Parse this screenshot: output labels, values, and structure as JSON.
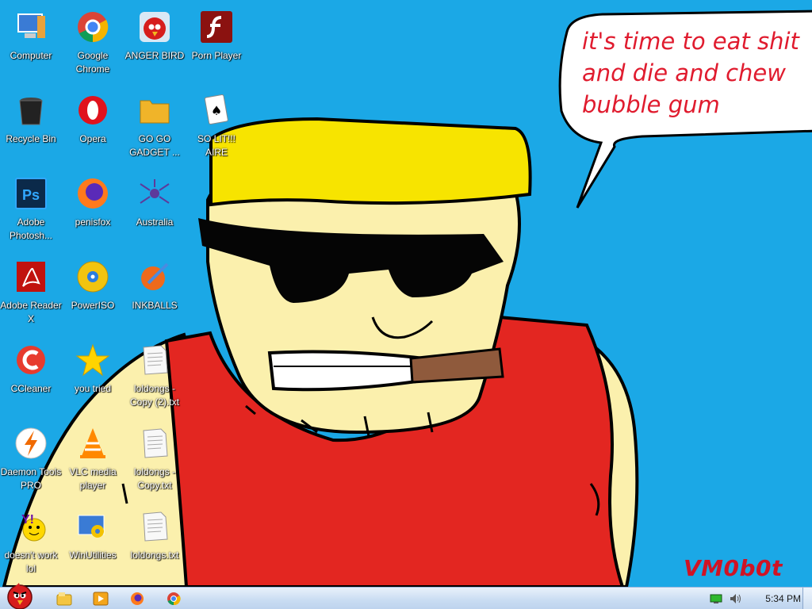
{
  "wallpaper": {
    "speech_bubble": "it's time to eat shit\nand die and chew\nbubble gum",
    "signature": "VM0b0t"
  },
  "desktop_icons": [
    {
      "label": "Computer",
      "icon": "computer-icon"
    },
    {
      "label": "Google Chrome",
      "icon": "chrome-icon"
    },
    {
      "label": "ANGER BIRD",
      "icon": "angry-bird-icon"
    },
    {
      "label": "Porn Player",
      "icon": "flash-player-icon"
    },
    {
      "label": "Recycle Bin",
      "icon": "recycle-bin-icon"
    },
    {
      "label": "Opera",
      "icon": "opera-icon"
    },
    {
      "label": "GO GO GADGET ...",
      "icon": "folder-icon"
    },
    {
      "label": "SO LIT!!! AIRE",
      "icon": "solitaire-icon"
    },
    {
      "label": "Adobe Photosh...",
      "icon": "photoshop-icon"
    },
    {
      "label": "penisfox",
      "icon": "firefox-icon"
    },
    {
      "label": "Australia",
      "icon": "spider-solitaire-icon"
    },
    {
      "label": "Adobe Reader X",
      "icon": "adobe-reader-icon"
    },
    {
      "label": "PowerISO",
      "icon": "poweriso-icon"
    },
    {
      "label": "INKBALLS",
      "icon": "inkball-icon"
    },
    {
      "label": "CCleaner",
      "icon": "ccleaner-icon"
    },
    {
      "label": "you tried",
      "icon": "star-icon"
    },
    {
      "label": "loldongs - Copy (2).txt",
      "icon": "text-file-icon"
    },
    {
      "label": "Daemon Tools PRO",
      "icon": "daemon-tools-icon"
    },
    {
      "label": "VLC media player",
      "icon": "vlc-icon"
    },
    {
      "label": "loldongs - Copy.txt",
      "icon": "text-file-icon"
    },
    {
      "label": "doesn't work lol",
      "icon": "yahoo-messenger-icon"
    },
    {
      "label": "WinUtilities",
      "icon": "winutilities-icon"
    },
    {
      "label": "loldongs.txt",
      "icon": "text-file-icon"
    }
  ],
  "taskbar": {
    "start_icon": "angry-bird-start-icon",
    "pinned": [
      "explorer-icon",
      "media-player-icon",
      "firefox-icon",
      "chrome-icon"
    ],
    "tray_icons": [
      "network-icon",
      "volume-icon"
    ],
    "clock": "5:34 PM"
  }
}
